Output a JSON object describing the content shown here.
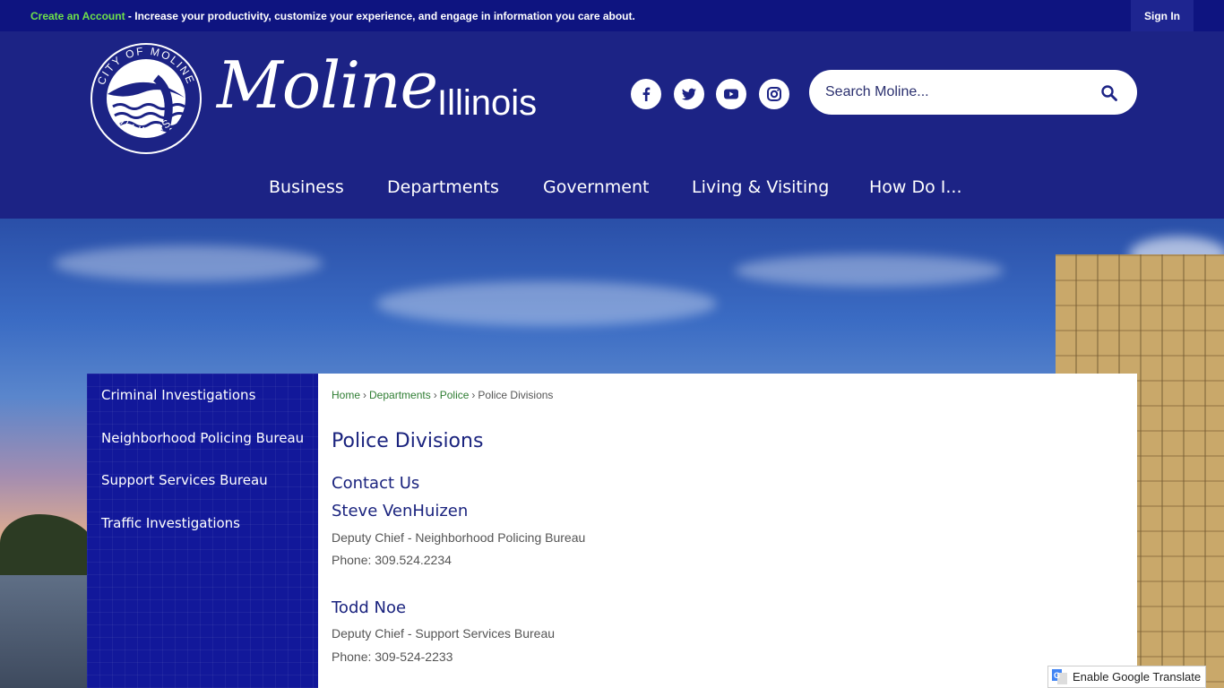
{
  "topbar": {
    "create_account": "Create an Account",
    "message": " - Increase your productivity, customize your experience, and engage in information you care about.",
    "signin": "Sign In"
  },
  "brand": {
    "seal_top": "CITY OF MOLINE",
    "seal_bottom": "ILLINOIS",
    "script": "Moline",
    "state": "Illinois"
  },
  "social": {
    "facebook": "facebook-icon",
    "twitter": "twitter-icon",
    "youtube": "youtube-icon",
    "instagram": "instagram-icon"
  },
  "search": {
    "placeholder": "Search Moline..."
  },
  "nav": {
    "items": [
      "Business",
      "Departments",
      "Government",
      "Living & Visiting",
      "How Do I..."
    ]
  },
  "sidebar": {
    "items": [
      "Criminal Investigations",
      "Neighborhood Policing Bureau",
      "Support Services Bureau",
      "Traffic Investigations"
    ]
  },
  "breadcrumb": {
    "home": "Home",
    "departments": "Departments",
    "police": "Police",
    "current": "Police Divisions",
    "separator": "›"
  },
  "main": {
    "title": "Police Divisions",
    "contact_heading": "Contact Us",
    "contacts": [
      {
        "name": "Steve VenHuizen",
        "title": "Deputy Chief - Neighborhood Policing Bureau",
        "phone": "Phone: 309.524.2234"
      },
      {
        "name": "Todd Noe",
        "title": "Deputy Chief - Support Services Bureau",
        "phone": "Phone: 309-524-2233"
      }
    ]
  },
  "translate": {
    "label": "Enable Google Translate"
  },
  "colors": {
    "header_bg": "#1c2385",
    "topbar_bg": "#0e1480",
    "link_green": "#6ee04a",
    "heading_navy": "#1a237e"
  }
}
